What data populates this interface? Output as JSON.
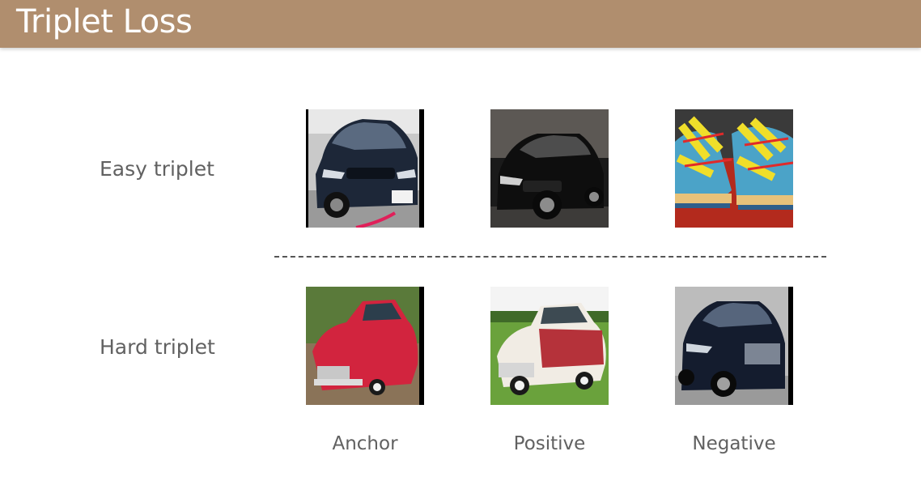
{
  "slide": {
    "title": "Triplet Loss"
  },
  "rows": [
    {
      "label": "Easy triplet",
      "images": [
        {
          "role": "anchor",
          "subject": "dark blue sedan, front three-quarter view"
        },
        {
          "role": "positive",
          "subject": "black sedan, front three-quarter view"
        },
        {
          "role": "negative",
          "subject": "pair of colorful sneakers"
        }
      ]
    },
    {
      "label": "Hard triplet",
      "images": [
        {
          "role": "anchor",
          "subject": "red classic car, rear three-quarter view"
        },
        {
          "role": "positive",
          "subject": "white and red classic car on grass"
        },
        {
          "role": "negative",
          "subject": "dark blue modern sedan"
        }
      ]
    }
  ],
  "columns": [
    {
      "label": "Anchor"
    },
    {
      "label": "Positive"
    },
    {
      "label": "Negative"
    }
  ],
  "colors": {
    "header_bg": "#b08e6e",
    "header_text": "#ffffff",
    "label_text": "#616161",
    "divider": "#555555"
  }
}
